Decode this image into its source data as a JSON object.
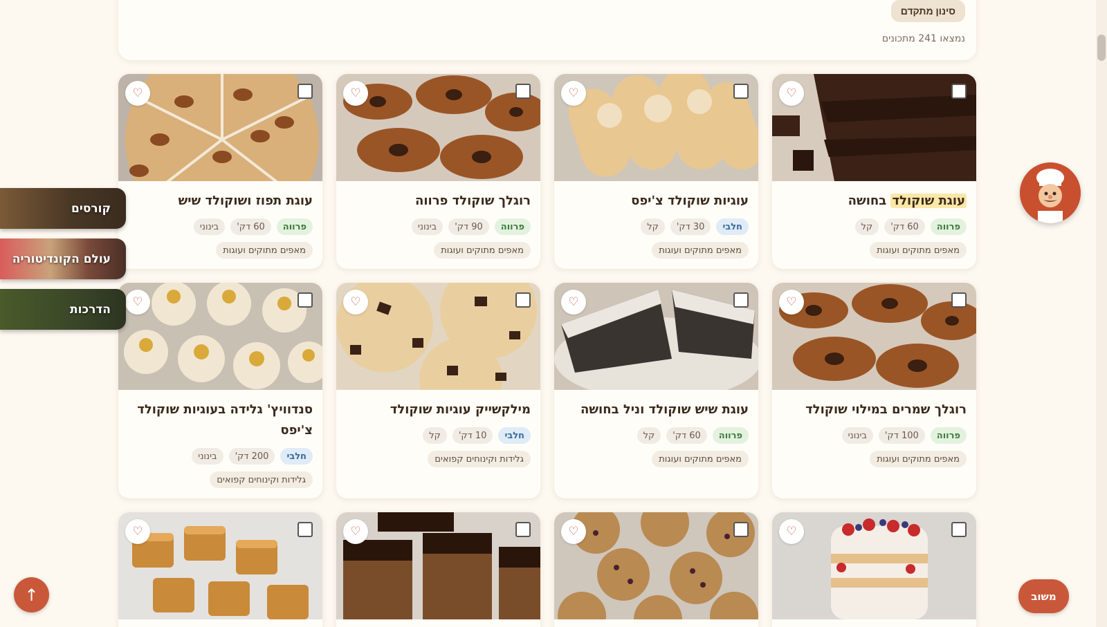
{
  "filters": {
    "advanced_filter_label": "סינון מתקדם",
    "results_count": "נמצאו 241 מתכונים"
  },
  "side_nav": {
    "courses": "קורסים",
    "pastry_world": "עולם הקונדיטוריה",
    "guides": "הדרכות"
  },
  "floating": {
    "back_to_top": "↑",
    "feedback": "משוב"
  },
  "icons": {
    "favorite": "♡"
  },
  "cards": [
    {
      "title_highlight": "עוגת שוקולד",
      "title_rest": " בחושה",
      "kosher": "פרווה",
      "kosher_type": "parve",
      "time": "60 דק'",
      "difficulty": "קל",
      "category": "מאפים מתוקים ועוגות",
      "image": "chocolate-cake"
    },
    {
      "title_highlight": "",
      "title_rest": "עוגיות שוקולד צ'יפס",
      "kosher": "חלבי",
      "kosher_type": "dairy",
      "time": "30 דק'",
      "difficulty": "קל",
      "category": "מאפים מתוקים ועוגות",
      "image": "ladyfingers"
    },
    {
      "title_highlight": "",
      "title_rest": "רוגלך שוקולד פרווה",
      "kosher": "פרווה",
      "kosher_type": "parve",
      "time": "90 דק'",
      "difficulty": "בינוני",
      "category": "מאפים מתוקים ועוגות",
      "image": "rugelach"
    },
    {
      "title_highlight": "",
      "title_rest": "עוגת תפוז ושוקולד שיש",
      "kosher": "פרווה",
      "kosher_type": "parve",
      "time": "60 דק'",
      "difficulty": "בינוני",
      "category": "מאפים מתוקים ועוגות",
      "image": "almond-cake"
    },
    {
      "title_highlight": "",
      "title_rest": "רוגלך שמרים במילוי שוקולד",
      "kosher": "פרווה",
      "kosher_type": "parve",
      "time": "100 דק'",
      "difficulty": "בינוני",
      "category": "מאפים מתוקים ועוגות",
      "image": "rugelach"
    },
    {
      "title_highlight": "",
      "title_rest": "עוגת שיש שוקולד וניל בחושה",
      "kosher": "פרווה",
      "kosher_type": "parve",
      "time": "60 דק'",
      "difficulty": "קל",
      "category": "מאפים מתוקים ועוגות",
      "image": "poppy-cake"
    },
    {
      "title_highlight": "",
      "title_rest": "מילקשייק עוגיות שוקולד",
      "kosher": "חלבי",
      "kosher_type": "dairy",
      "time": "10 דק'",
      "difficulty": "קל",
      "category": "גלידות וקינוחים קפואים",
      "image": "chip-cookies"
    },
    {
      "title_highlight": "",
      "title_rest": "סנדוויץ' גלידה בעוגיות שוקולד צ'יפס",
      "kosher": "חלבי",
      "kosher_type": "dairy",
      "time": "200 דק'",
      "difficulty": "בינוני",
      "category": "גלידות וקינוחים קפואים",
      "image": "macarons"
    },
    {
      "title_highlight": "",
      "title_rest": "",
      "kosher": "",
      "kosher_type": "",
      "time": "",
      "difficulty": "",
      "category": "",
      "image": "trifle"
    },
    {
      "title_highlight": "",
      "title_rest": "",
      "kosher": "",
      "kosher_type": "",
      "time": "",
      "difficulty": "",
      "category": "",
      "image": "oat-cookies"
    },
    {
      "title_highlight": "",
      "title_rest": "",
      "kosher": "",
      "kosher_type": "",
      "time": "",
      "difficulty": "",
      "category": "",
      "image": "brownies"
    },
    {
      "title_highlight": "",
      "title_rest": "",
      "kosher": "",
      "kosher_type": "",
      "time": "",
      "difficulty": "",
      "category": "",
      "image": "caramels"
    }
  ]
}
